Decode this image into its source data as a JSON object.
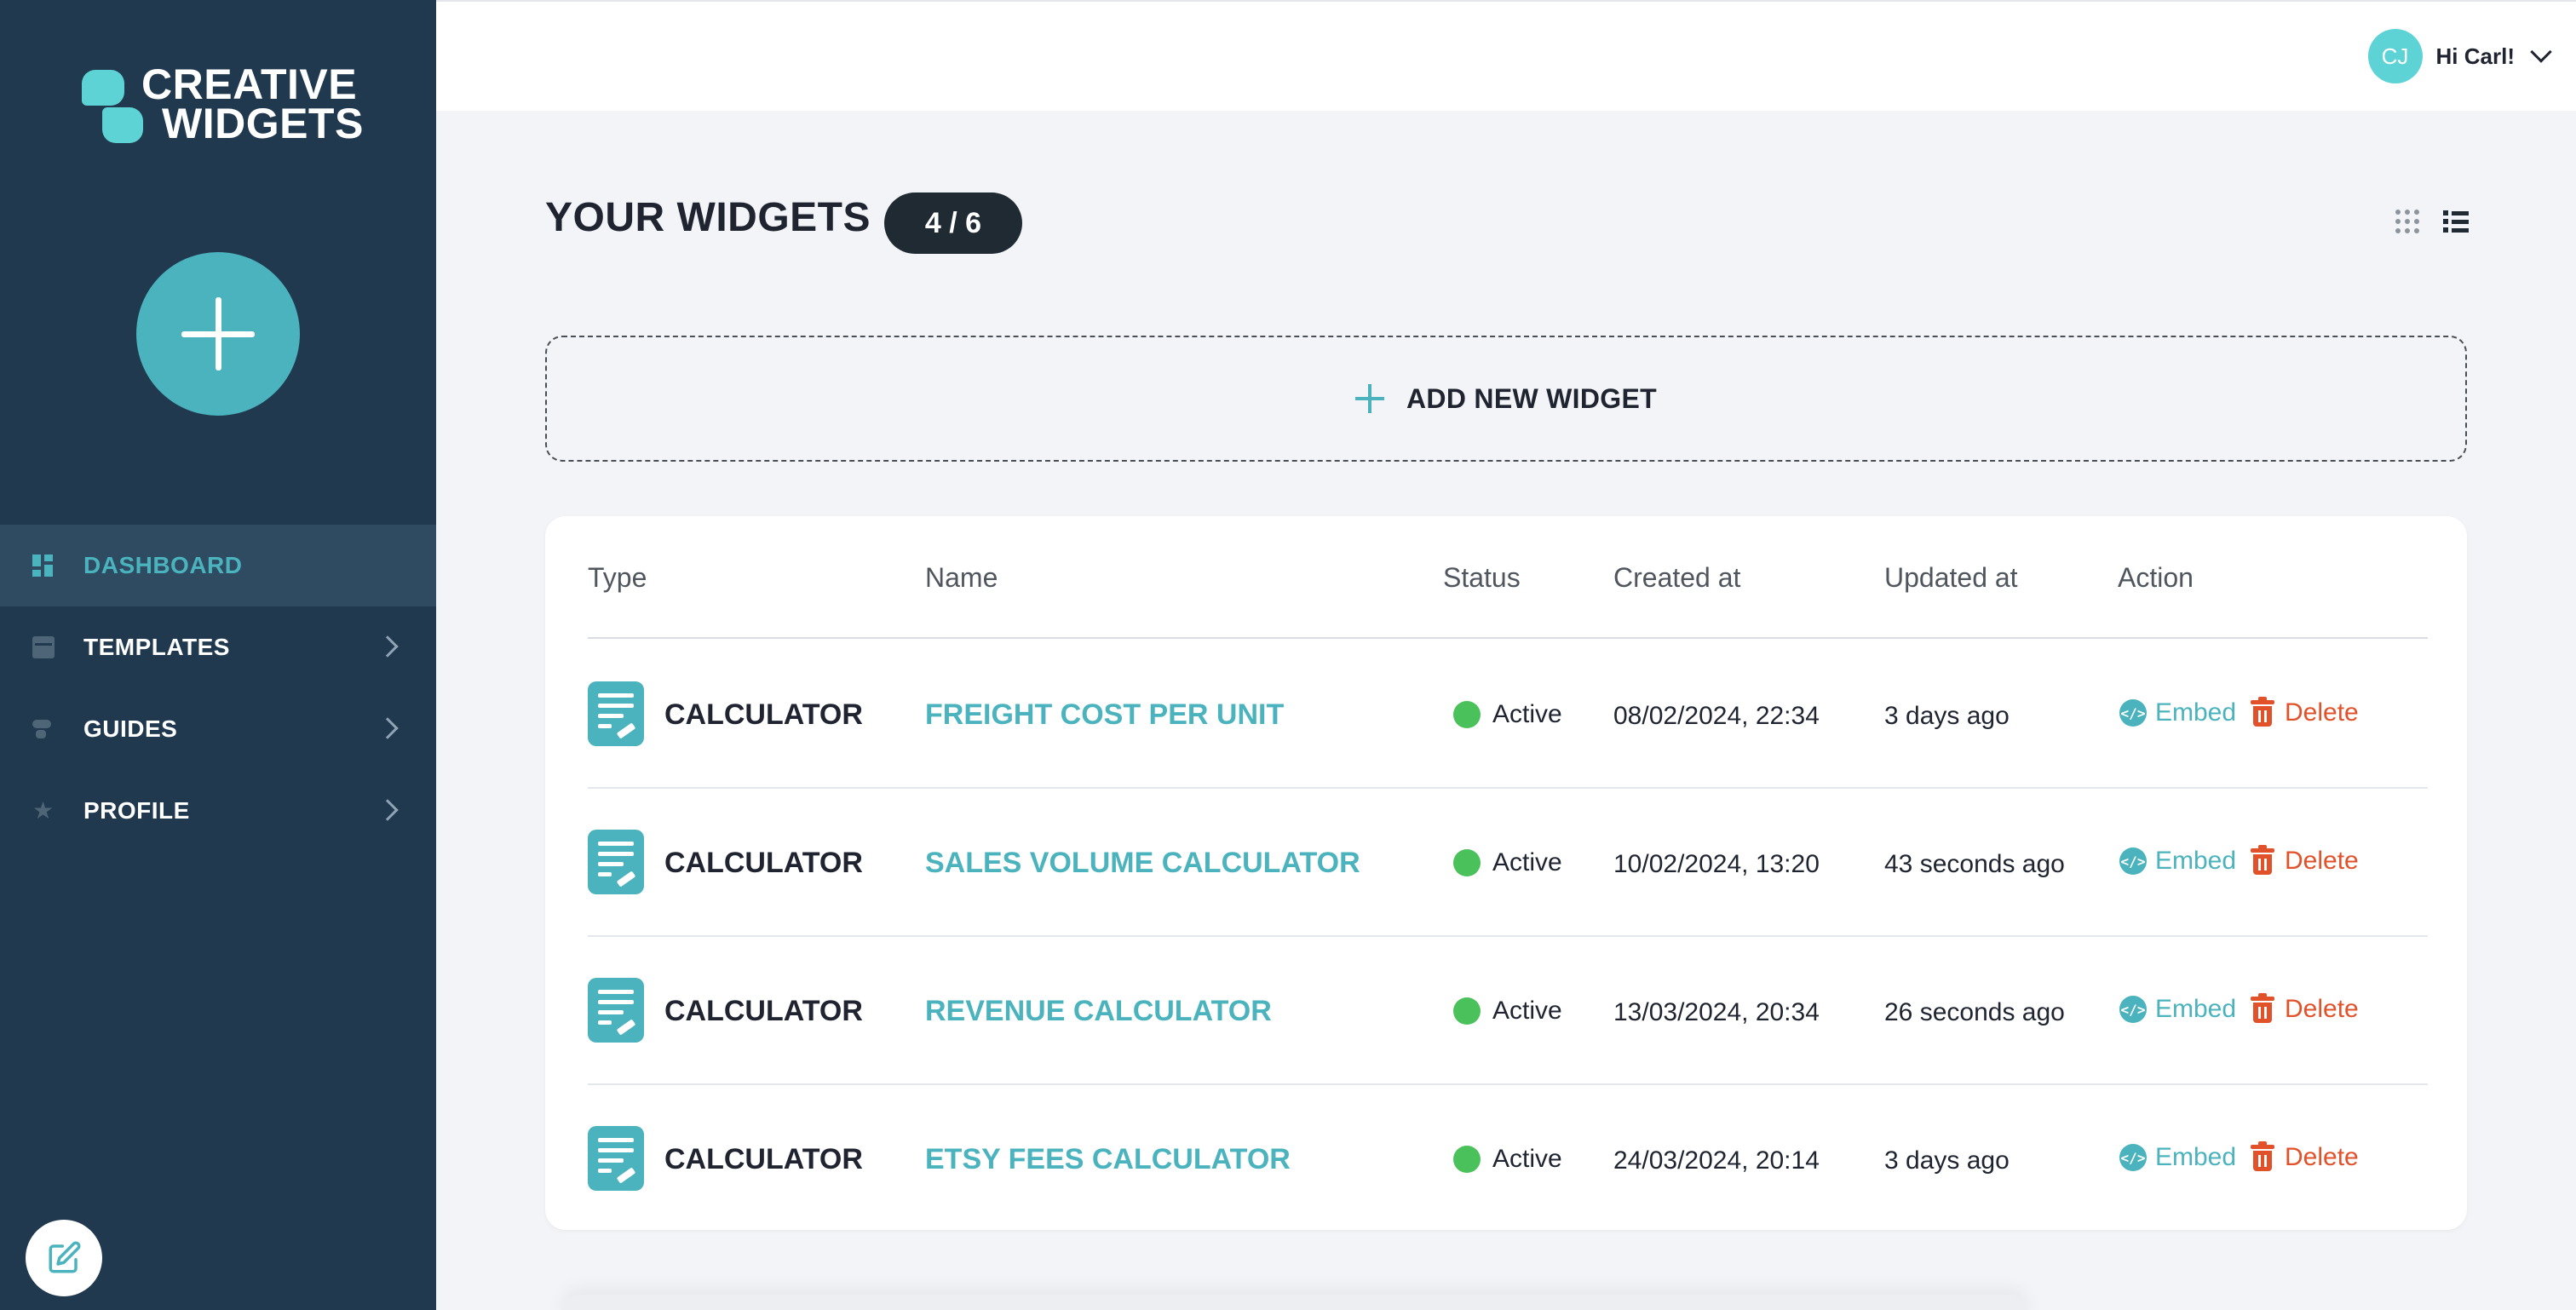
{
  "brand": {
    "line1": "CREATIVE",
    "line2": "WIDGETS"
  },
  "sidebar": {
    "items": [
      {
        "label": "DASHBOARD",
        "icon": "dashboard-icon",
        "active": true
      },
      {
        "label": "TEMPLATES",
        "icon": "templates-icon",
        "active": false
      },
      {
        "label": "GUIDES",
        "icon": "guides-icon",
        "active": false
      },
      {
        "label": "PROFILE",
        "icon": "star-icon",
        "active": false
      }
    ]
  },
  "header": {
    "avatar_initials": "CJ",
    "greeting": "Hi Carl!"
  },
  "main": {
    "title": "YOUR WIDGETS",
    "count": "4 / 6",
    "add_widget_label": "ADD NEW WIDGET"
  },
  "table": {
    "columns": [
      "Type",
      "Name",
      "Status",
      "Created at",
      "Updated at",
      "Action"
    ],
    "rows": [
      {
        "type": "CALCULATOR",
        "name": "FREIGHT COST PER UNIT",
        "status": "Active",
        "created": "08/02/2024, 22:34",
        "updated": "3 days ago"
      },
      {
        "type": "CALCULATOR",
        "name": "SALES VOLUME CALCULATOR",
        "status": "Active",
        "created": "10/02/2024, 13:20",
        "updated": "43 seconds ago"
      },
      {
        "type": "CALCULATOR",
        "name": "REVENUE CALCULATOR",
        "status": "Active",
        "created": "13/03/2024, 20:34",
        "updated": "26 seconds ago"
      },
      {
        "type": "CALCULATOR",
        "name": "ETSY FEES CALCULATOR",
        "status": "Active",
        "created": "24/03/2024, 20:14",
        "updated": "3 days ago"
      }
    ],
    "embed_label": "Embed",
    "delete_label": "Delete",
    "embed_glyph": "</>"
  },
  "colors": {
    "sidebar_bg": "#20394f",
    "accent": "#4ab3bd",
    "active_status": "#4bc15b",
    "danger": "#e2522a"
  }
}
